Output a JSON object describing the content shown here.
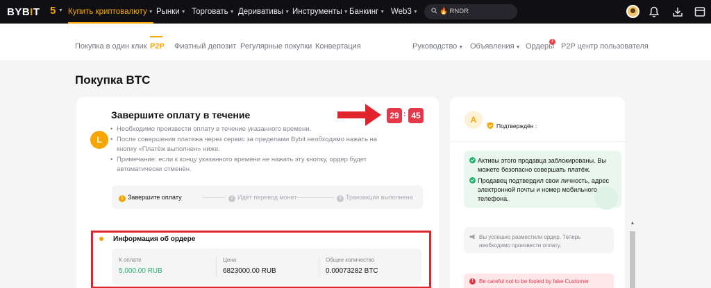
{
  "header": {
    "logo": {
      "part1": "BYB",
      "accent": "I",
      "part2": "T"
    },
    "five_label": "5",
    "nav": [
      {
        "label": "Купить криптовалюту"
      },
      {
        "label": "Рынки"
      },
      {
        "label": "Торговать"
      },
      {
        "label": "Деривативы"
      },
      {
        "label": "Инструменты"
      },
      {
        "label": "Банкинг"
      },
      {
        "label": "Web3"
      }
    ],
    "search": {
      "value": "RNDR"
    }
  },
  "subnav": {
    "left": [
      "Покупка в один клик",
      "P2P",
      "Фиатный депозит",
      "Регулярные покупки",
      "Конвертация"
    ],
    "right": [
      "Руководство",
      "Объявления",
      "Ордеры",
      "P2P центр пользователя"
    ],
    "orders_badge": "1"
  },
  "page": {
    "title": "Покупка BTC"
  },
  "payment": {
    "avatar_letter": "L",
    "title": "Завершите оплату в течение",
    "bullets": [
      "Необходимо произвести оплату в течение указанного времени.",
      "После совершения платежа через сервис за пределами Bybit необходимо нажать на кнопку «Платёж выполнен» ниже.",
      "Примечание: если к концу указанного времени не нажать эту кнопку, ордер будет автоматически отменён."
    ],
    "timer": {
      "minutes": "29",
      "separator": ":",
      "seconds": "45"
    },
    "steps": [
      {
        "num": "1",
        "label": "Завершите оплату"
      },
      {
        "num": "2",
        "label": "Идёт перевод монет"
      },
      {
        "num": "3",
        "label": "Транзакция выполнена"
      }
    ]
  },
  "order": {
    "title": "Информация об ордере",
    "fields": [
      {
        "label": "К оплате",
        "value": "5,000.00 RUB"
      },
      {
        "label": "Цена",
        "value": "6823000.00 RUB"
      },
      {
        "label": "Общее количество",
        "value": "0.00073282 BTC"
      }
    ]
  },
  "seller": {
    "avatar_letter": "A",
    "verified_label": "Подтверждён :",
    "notices": [
      "Активы этого продавца заблокированы. Вы можете безопасно совершать платёж.",
      "Продавец подтвердил свои личность, адрес электронной почты и номер мобильного телефона."
    ],
    "chat_system_message": "Вы успешно разместили ордер. Теперь необходимо произвести оплату.",
    "warning": "Be careful not to be fooled by fake Customer"
  },
  "colors": {
    "accent": "#f7a600",
    "timer": "#e3394a",
    "success": "#20b26c",
    "highlight_border": "#e0232c"
  }
}
